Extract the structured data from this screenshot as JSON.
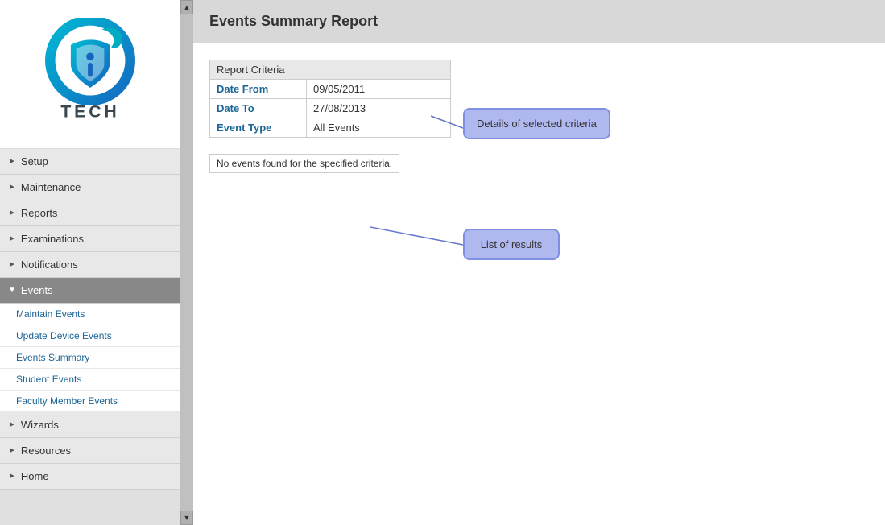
{
  "page": {
    "title": "Events Summary Report"
  },
  "sidebar": {
    "logo_text": "TECH",
    "nav_items": [
      {
        "id": "setup",
        "label": "Setup",
        "expanded": false,
        "active": false
      },
      {
        "id": "maintenance",
        "label": "Maintenance",
        "expanded": false,
        "active": false
      },
      {
        "id": "reports",
        "label": "Reports",
        "expanded": false,
        "active": false
      },
      {
        "id": "examinations",
        "label": "Examinations",
        "expanded": false,
        "active": false
      },
      {
        "id": "notifications",
        "label": "Notifications",
        "expanded": false,
        "active": false
      },
      {
        "id": "events",
        "label": "Events",
        "expanded": true,
        "active": true
      },
      {
        "id": "wizards",
        "label": "Wizards",
        "expanded": false,
        "active": false
      },
      {
        "id": "resources",
        "label": "Resources",
        "expanded": false,
        "active": false
      },
      {
        "id": "home",
        "label": "Home",
        "expanded": false,
        "active": false
      }
    ],
    "events_subitems": [
      "Maintain Events",
      "Update Device Events",
      "Events Summary",
      "Student Events",
      "Faculty Member Events"
    ]
  },
  "report_criteria": {
    "header": "Report Criteria",
    "fields": [
      {
        "label": "Date From",
        "value": "09/05/2011"
      },
      {
        "label": "Date To",
        "value": "27/08/2013"
      },
      {
        "label": "Event Type",
        "value": "All Events"
      }
    ]
  },
  "results": {
    "no_results_message": "No events found for the specified criteria."
  },
  "annotations": {
    "criteria_label": "Details of selected criteria",
    "results_label": "List of results"
  }
}
